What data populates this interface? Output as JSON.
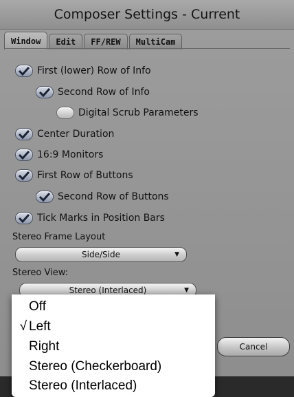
{
  "window": {
    "title": "Composer Settings - Current"
  },
  "tabs": [
    {
      "label": "Window",
      "active": true
    },
    {
      "label": "Edit",
      "active": false
    },
    {
      "label": "FF/REW",
      "active": false
    },
    {
      "label": "MultiCam",
      "active": false
    }
  ],
  "options": [
    {
      "label": "First (lower) Row of Info",
      "checked": true
    },
    {
      "label": "Second Row of Info",
      "checked": true
    },
    {
      "label": "Digital Scrub Parameters",
      "checked": false
    },
    {
      "label": "Center Duration",
      "checked": true
    },
    {
      "label": "16:9 Monitors",
      "checked": true
    },
    {
      "label": "First Row of Buttons",
      "checked": true
    },
    {
      "label": "Second Row of Buttons",
      "checked": true
    },
    {
      "label": "Tick Marks in Position Bars",
      "checked": true
    }
  ],
  "stereo_frame_layout": {
    "label": "Stereo Frame Layout",
    "value": "Side/Side"
  },
  "stereo_view": {
    "label": "Stereo View:",
    "value": "Stereo (Interlaced)",
    "menu_items": [
      {
        "label": "Off",
        "checked": false
      },
      {
        "label": "Left",
        "checked": true
      },
      {
        "label": "Right",
        "checked": false
      },
      {
        "label": "Stereo (Checkerboard)",
        "checked": false
      },
      {
        "label": "Stereo (Interlaced)",
        "checked": false
      }
    ]
  },
  "buttons": {
    "cancel": "Cancel"
  },
  "glyphs": {
    "menu_check": "√",
    "dropdown_arrow": "▼"
  },
  "colors": {
    "checkbox_on": "#8f98ab",
    "window_bg": "#9d9d9d",
    "menu_bg": "#ffffff"
  }
}
